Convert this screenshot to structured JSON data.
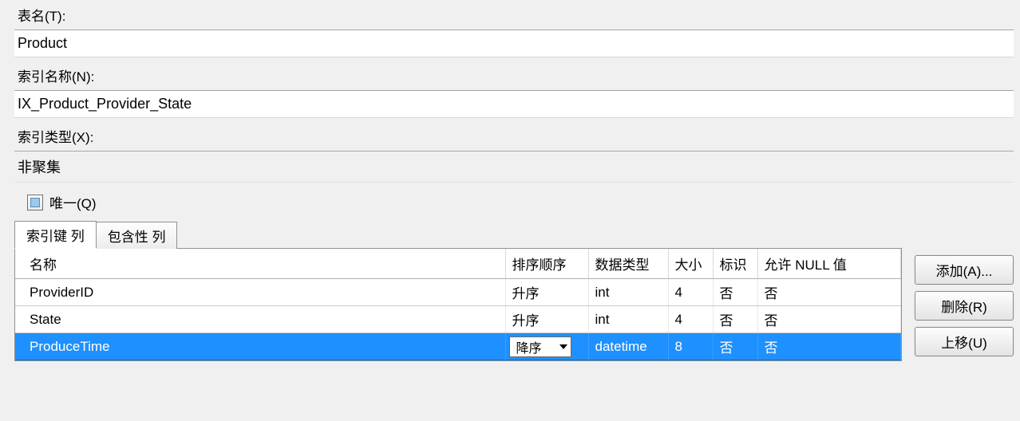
{
  "labels": {
    "table_name": "表名(T):",
    "index_name": "索引名称(N):",
    "index_type": "索引类型(X):",
    "unique": "唯一(Q)"
  },
  "values": {
    "table_name": "Product",
    "index_name": "IX_Product_Provider_State",
    "index_type": "非聚集",
    "unique_checked": false
  },
  "tabs": [
    {
      "label": "索引键 列",
      "active": true
    },
    {
      "label": "包含性 列",
      "active": false
    }
  ],
  "grid": {
    "headers": {
      "name": "名称",
      "sort": "排序顺序",
      "dtype": "数据类型",
      "size": "大小",
      "ident": "标识",
      "nullable": "允许 NULL 值"
    },
    "rows": [
      {
        "name": "ProviderID",
        "sort": "升序",
        "dtype": "int",
        "size": "4",
        "ident": "否",
        "nullable": "否",
        "selected": false,
        "sort_editing": false
      },
      {
        "name": "State",
        "sort": "升序",
        "dtype": "int",
        "size": "4",
        "ident": "否",
        "nullable": "否",
        "selected": false,
        "sort_editing": false
      },
      {
        "name": "ProduceTime",
        "sort": "降序",
        "dtype": "datetime",
        "size": "8",
        "ident": "否",
        "nullable": "否",
        "selected": true,
        "sort_editing": true
      }
    ]
  },
  "buttons": {
    "add": "添加(A)...",
    "remove": "删除(R)",
    "up": "上移(U)"
  }
}
